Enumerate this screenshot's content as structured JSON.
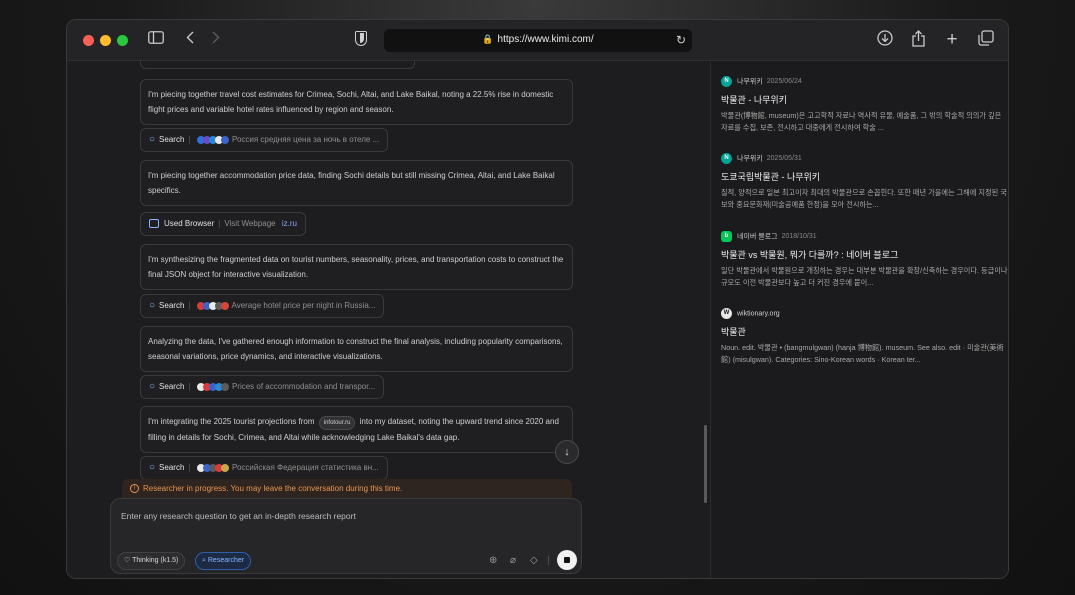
{
  "browser": {
    "url": "https://www.kimi.com/",
    "icons": [
      "sidebar-icon",
      "back-icon",
      "forward-icon",
      "shield-icon",
      "lock-icon",
      "reload-icon",
      "download-icon",
      "share-icon",
      "new-tab-icon",
      "tabs-icon"
    ]
  },
  "chat": {
    "messages": [
      {
        "type": "text",
        "text": "I'm piecing together travel cost estimates for Crimea, Sochi, Altai, and Lake Baikal, noting a 22.5% rise in domestic flight prices and variable hotel rates influenced by region and season."
      },
      {
        "type": "search",
        "label": "Search",
        "query": "Россия средняя цена за ночь в отеле ..."
      },
      {
        "type": "text",
        "text": "I'm piecing together accommodation price data, finding Sochi details but still missing Crimea, Altai, and Lake Baikal specifics."
      },
      {
        "type": "browser",
        "label": "Used Browser",
        "action": "Visit Webpage",
        "site": "iz.ru"
      },
      {
        "type": "text",
        "text": "I'm synthesizing the fragmented data on tourist numbers, seasonality, prices, and transportation costs to construct the final JSON object for interactive visualization."
      },
      {
        "type": "search",
        "label": "Search",
        "query": "Average hotel price per night in Russia..."
      },
      {
        "type": "text",
        "text": "Analyzing the data, I've gathered enough information to construct the final analysis, including popularity comparisons, seasonal variations, price dynamics, and interactive visualizations."
      },
      {
        "type": "search",
        "label": "Search",
        "query": "Prices of accommodation and transpor..."
      },
      {
        "type": "text_chip",
        "before": "I'm integrating the 2025 tourist projections from",
        "chip": "infotour.ru",
        "after": "into my dataset, noting the upward trend since 2020 and filling in details for Sochi, Crimea, and Altai while acknowledging Lake Baikal's data gap."
      },
      {
        "type": "search",
        "label": "Search",
        "query": "Российская Федерация статистика вн..."
      }
    ],
    "notice": "Researcher in progress. You may leave the conversation during this time.",
    "input_placeholder": "Enter any research question to get an in-depth research report",
    "mode_thinking": "Thinking (k1.5)",
    "mode_researcher": "Researcher"
  },
  "results": [
    {
      "source": "나무위키",
      "date": "2025/06/24",
      "icon_color": "#00a495",
      "title": "박물관 - 나무위키",
      "snippet": "박물관(博物館, museum)은 고고학적 자료나 역사적 유물, 예술품, 그 밖의 학술적 의의가 깊은 자료를 수집, 보존, 전시하고 대중에게 전시하여 학술 ..."
    },
    {
      "source": "나무위키",
      "date": "2025/05/31",
      "icon_color": "#00a495",
      "title": "도쿄국립박물관 - 나무위키",
      "snippet": "질적, 양적으로 일본 최고이자 최대의 박물관으로 손꼽힌다. 또한 매년 가을에는 그해에 지정된 국보와 중요문화재(미술공예품 한정)을 모아 전시하는..."
    },
    {
      "source": "네이버 블로그",
      "date": "2018/10/31",
      "icon_color": "#03c75a",
      "title": "박물관 vs 박물원, 뭐가 다를까? : 네이버 블로그",
      "snippet": "일단 박물관에서 박물원으로 개칭하는 경우는 대부분 박물관을 확장/신축하는 경우이다. 등급이나 규모도 이전 박물관보다 높고 더 커진 경우에 붙이..."
    },
    {
      "source": "wiktionary.org",
      "date": "",
      "icon_color": "#e8e8e8",
      "title": "박물관",
      "snippet": "Noun. edit. 박물관 • (bangmulgwan) (hanja 博物館). museum. See also. edit · 미술관(美術館) (misulgwan). Categories: Sino-Korean words · Korean ter..."
    }
  ]
}
